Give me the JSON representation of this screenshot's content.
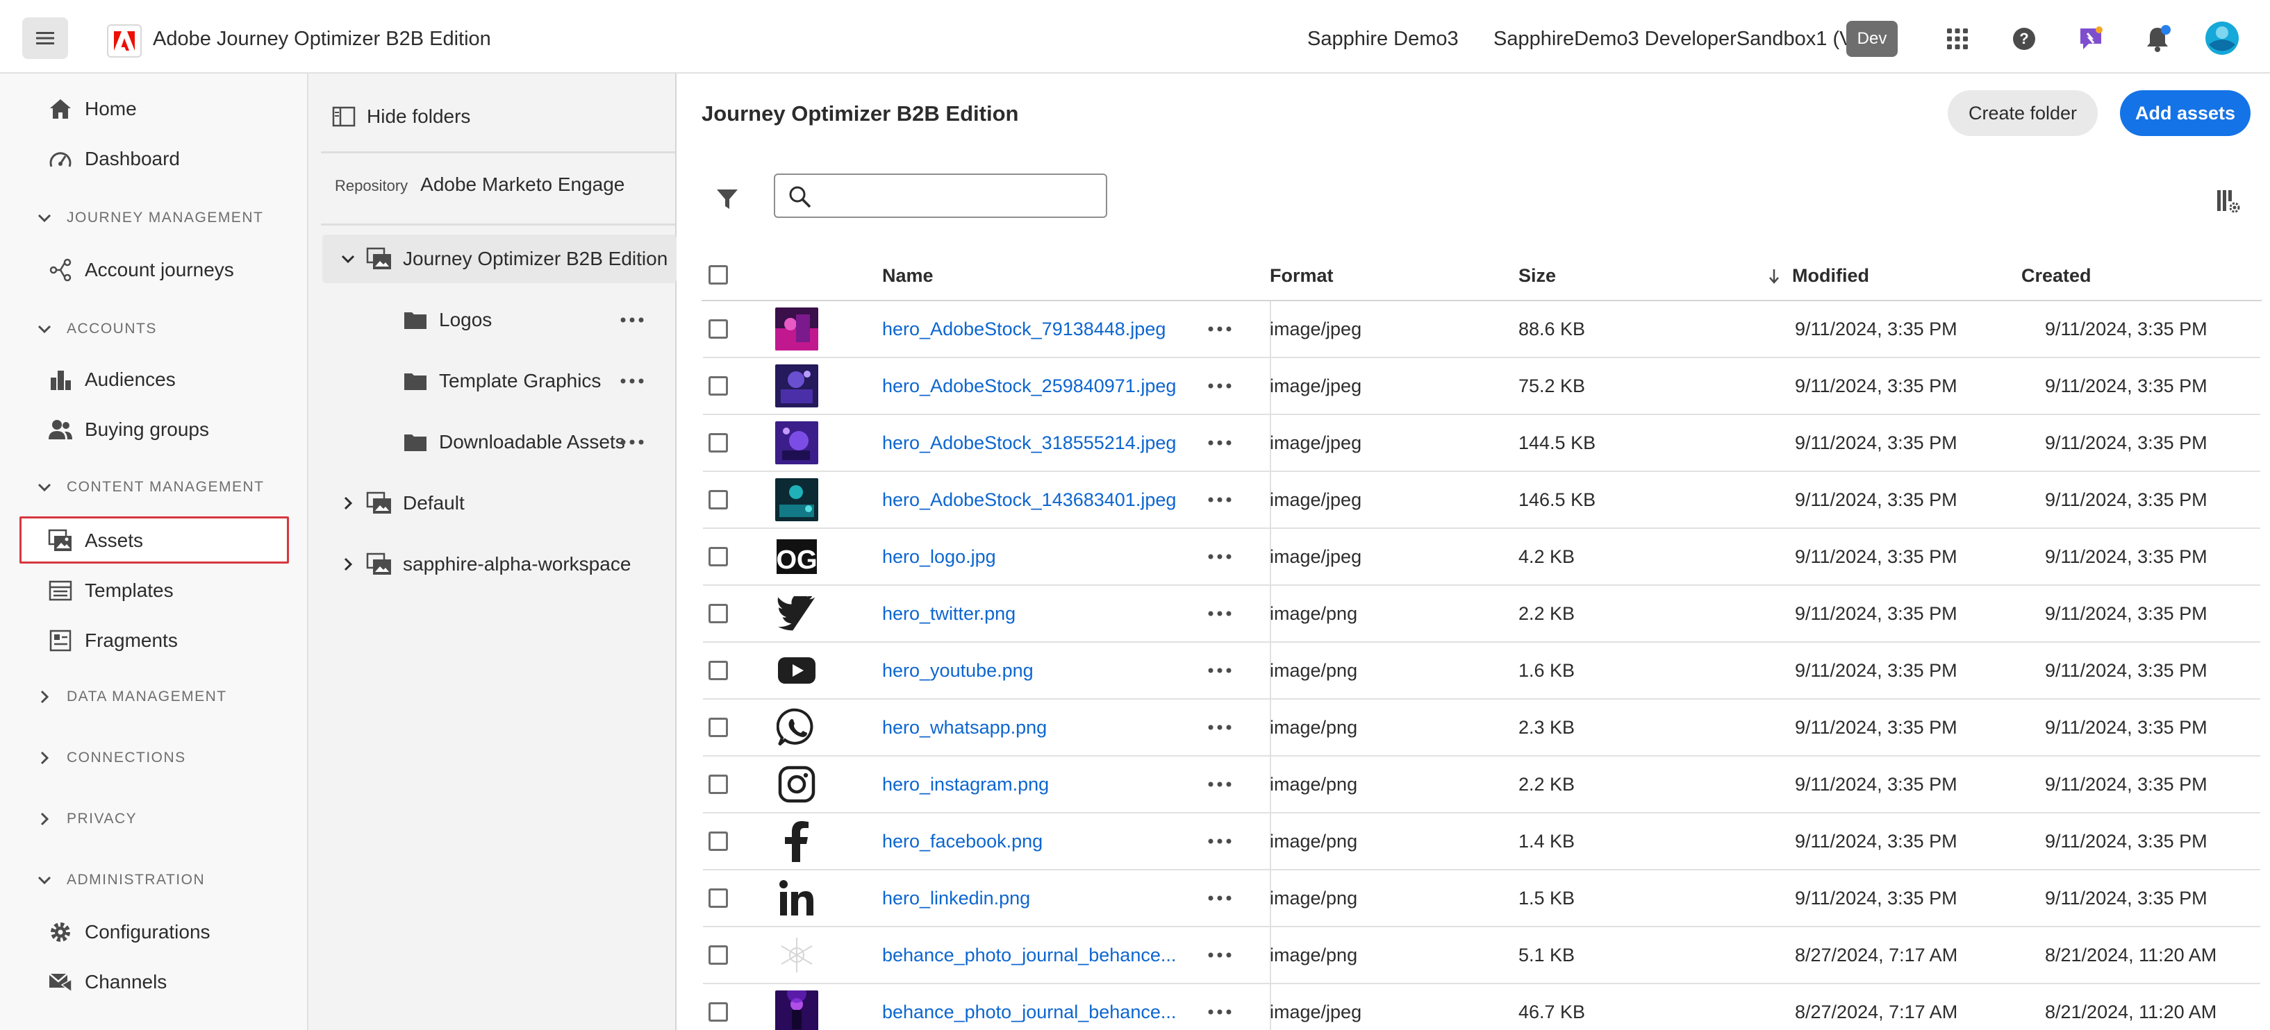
{
  "topbar": {
    "app_title": "Adobe Journey Optimizer B2B Edition",
    "org_name": "Sapphire Demo3",
    "sandbox_name": "SapphireDemo3 DeveloperSandbox1 (VA7)",
    "env_badge": "Dev",
    "icons": [
      "menu-icon",
      "adobe-logo",
      "apps-grid-icon",
      "help-icon",
      "feedback-icon",
      "notifications-icon",
      "avatar"
    ],
    "colors": {
      "adobe_red": "#eb1000",
      "feedback_purple": "#7e4ecf",
      "notification_dot": "#2680eb",
      "avatar": "#15a8d8"
    }
  },
  "nav": {
    "home": "Home",
    "dashboard": "Dashboard",
    "section_journey": "JOURNEY MANAGEMENT",
    "account_journeys": "Account journeys",
    "section_accounts": "ACCOUNTS",
    "audiences": "Audiences",
    "buying_groups": "Buying groups",
    "section_content": "CONTENT MANAGEMENT",
    "assets": "Assets",
    "templates": "Templates",
    "fragments": "Fragments",
    "section_data": "DATA MANAGEMENT",
    "section_connections": "CONNECTIONS",
    "section_privacy": "PRIVACY",
    "section_admin": "ADMINISTRATION",
    "configurations": "Configurations",
    "channels": "Channels",
    "selected_highlight": "#d7373f"
  },
  "folders": {
    "hide_label": "Hide folders",
    "repo_label": "Repository",
    "repo_value": "Adobe Marketo Engage",
    "root": "Journey Optimizer B2B Edition",
    "children": [
      "Logos",
      "Template Graphics",
      "Downloadable Assets"
    ],
    "siblings": [
      "Default",
      "sapphire-alpha-workspace"
    ]
  },
  "main": {
    "title": "Journey Optimizer B2B Edition",
    "create_folder": "Create folder",
    "add_assets": "Add assets",
    "search_placeholder": "",
    "primary_color": "#1473e6",
    "columns": {
      "name": "Name",
      "format": "Format",
      "size": "Size",
      "modified": "Modified",
      "created": "Created"
    },
    "sort": {
      "column": "Modified",
      "direction": "descending"
    },
    "rows": [
      {
        "name": "hero_AdobeStock_79138448.jpeg",
        "format": "image/jpeg",
        "size": "88.6 KB",
        "modified": "9/11/2024, 3:35 PM",
        "created": "9/11/2024, 3:35 PM",
        "thumb": "photo-magenta"
      },
      {
        "name": "hero_AdobeStock_259840971.jpeg",
        "format": "image/jpeg",
        "size": "75.2 KB",
        "modified": "9/11/2024, 3:35 PM",
        "created": "9/11/2024, 3:35 PM",
        "thumb": "photo-violet"
      },
      {
        "name": "hero_AdobeStock_318555214.jpeg",
        "format": "image/jpeg",
        "size": "144.5 KB",
        "modified": "9/11/2024, 3:35 PM",
        "created": "9/11/2024, 3:35 PM",
        "thumb": "photo-purple"
      },
      {
        "name": "hero_AdobeStock_143683401.jpeg",
        "format": "image/jpeg",
        "size": "146.5 KB",
        "modified": "9/11/2024, 3:35 PM",
        "created": "9/11/2024, 3:35 PM",
        "thumb": "photo-teal"
      },
      {
        "name": "hero_logo.jpg",
        "format": "image/jpeg",
        "size": "4.2 KB",
        "modified": "9/11/2024, 3:35 PM",
        "created": "9/11/2024, 3:35 PM",
        "thumb": "og-logo"
      },
      {
        "name": "hero_twitter.png",
        "format": "image/png",
        "size": "2.2 KB",
        "modified": "9/11/2024, 3:35 PM",
        "created": "9/11/2024, 3:35 PM",
        "thumb": "twitter-icon"
      },
      {
        "name": "hero_youtube.png",
        "format": "image/png",
        "size": "1.6 KB",
        "modified": "9/11/2024, 3:35 PM",
        "created": "9/11/2024, 3:35 PM",
        "thumb": "youtube-icon"
      },
      {
        "name": "hero_whatsapp.png",
        "format": "image/png",
        "size": "2.3 KB",
        "modified": "9/11/2024, 3:35 PM",
        "created": "9/11/2024, 3:35 PM",
        "thumb": "whatsapp-icon"
      },
      {
        "name": "hero_instagram.png",
        "format": "image/png",
        "size": "2.2 KB",
        "modified": "9/11/2024, 3:35 PM",
        "created": "9/11/2024, 3:35 PM",
        "thumb": "instagram-icon"
      },
      {
        "name": "hero_facebook.png",
        "format": "image/png",
        "size": "1.4 KB",
        "modified": "9/11/2024, 3:35 PM",
        "created": "9/11/2024, 3:35 PM",
        "thumb": "facebook-icon"
      },
      {
        "name": "hero_linkedin.png",
        "format": "image/png",
        "size": "1.5 KB",
        "modified": "9/11/2024, 3:35 PM",
        "created": "9/11/2024, 3:35 PM",
        "thumb": "linkedin-icon"
      },
      {
        "name": "behance_photo_journal_behance...",
        "format": "image/png",
        "size": "5.1 KB",
        "modified": "8/27/2024, 7:17 AM",
        "created": "8/21/2024, 11:20 AM",
        "thumb": "snowflake"
      },
      {
        "name": "behance_photo_journal_behance...",
        "format": "image/jpeg",
        "size": "46.7 KB",
        "modified": "8/27/2024, 7:17 AM",
        "created": "8/21/2024, 11:20 AM",
        "thumb": "photo-concert"
      }
    ]
  }
}
